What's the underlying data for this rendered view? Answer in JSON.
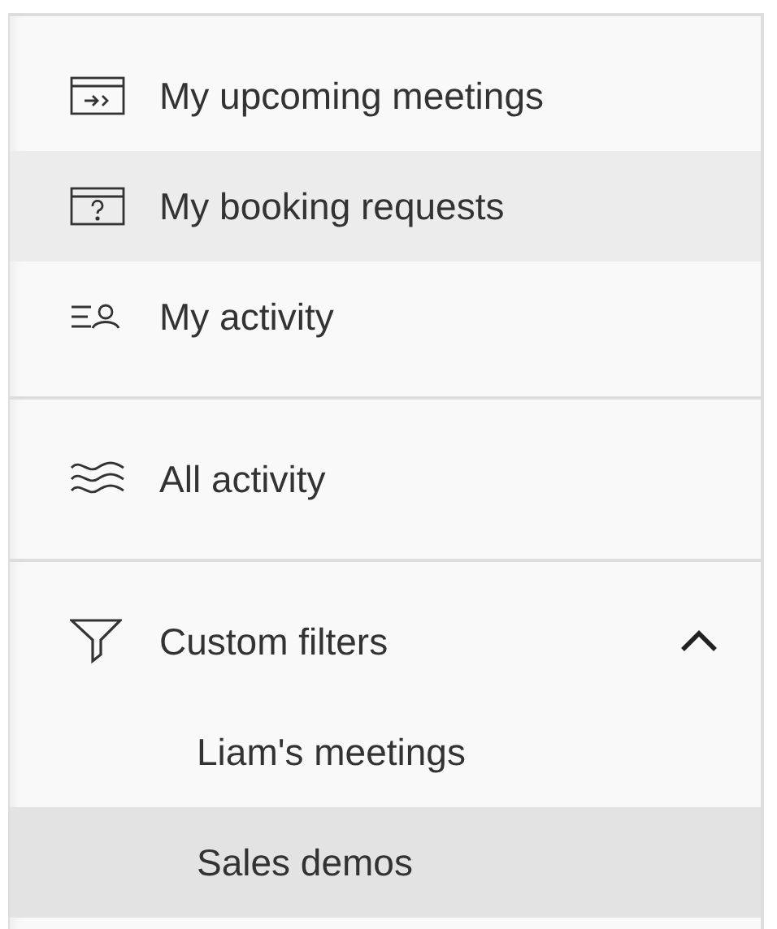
{
  "sections": [
    {
      "items": [
        {
          "kind": "link",
          "label": "My upcoming meetings",
          "selected": false
        },
        {
          "kind": "link",
          "label": "My booking requests",
          "selected": true
        },
        {
          "kind": "link",
          "label": "My activity",
          "selected": false
        }
      ]
    },
    {
      "items": [
        {
          "kind": "link",
          "label": "All activity",
          "selected": false
        }
      ]
    },
    {
      "items": [
        {
          "kind": "group",
          "label": "Custom filters",
          "expanded": true,
          "children": [
            {
              "label": "Liam's meetings",
              "selected": false
            },
            {
              "label": "Sales demos",
              "selected": true
            }
          ]
        }
      ]
    }
  ]
}
